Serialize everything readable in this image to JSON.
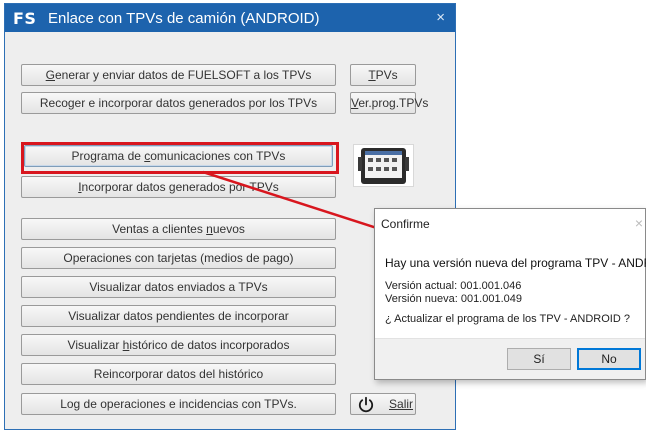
{
  "window": {
    "badge": "FS",
    "title": "Enlace con TPVs de camión (ANDROID)",
    "close": "×"
  },
  "buttons": {
    "generar": {
      "pre": "",
      "acc": "G",
      "post": "enerar y enviar datos de FUELSOFT a los TPVs"
    },
    "recoger": {
      "pre": "Recoger e incorporar datos generados por los TPVs",
      "acc": "",
      "post": ""
    },
    "programa": {
      "pre": "Programa de ",
      "acc": "c",
      "post": "omunicaciones con TPVs"
    },
    "incorporar": {
      "pre": "",
      "acc": "I",
      "post": "ncorporar datos generados por TPVs"
    },
    "ventas": {
      "pre": "Ventas a clientes ",
      "acc": "n",
      "post": "uevos"
    },
    "operaciones": {
      "pre": "Operaciones con tarjetas (medios de pago)",
      "acc": "",
      "post": ""
    },
    "visualizar_enviados": {
      "pre": "Visualizar datos enviados a TPVs",
      "acc": "",
      "post": ""
    },
    "visualizar_pendientes": {
      "pre": "Visualizar datos pendientes de incorporar",
      "acc": "",
      "post": ""
    },
    "visualizar_historico": {
      "pre": "Visualizar ",
      "acc": "h",
      "post": "istórico de datos incorporados"
    },
    "reincorporar": {
      "pre": "Reincorporar datos del histórico",
      "acc": "",
      "post": ""
    },
    "log": {
      "pre": "Log de operaciones e incidencias con TPVs.",
      "acc": "",
      "post": ""
    },
    "tpvs": {
      "pre": "",
      "acc": "T",
      "post": "PVs"
    },
    "ver_prog": {
      "pre": "",
      "acc": "V",
      "post": "er.prog.TPVs"
    },
    "salir": {
      "pre": "",
      "acc": "S",
      "post": "alir"
    }
  },
  "dialog": {
    "title": "Confirme",
    "close": "×",
    "message": "Hay una versión nueva del programa TPV - ANDROID.",
    "version_actual": "Versión actual: 001.001.046",
    "version_nueva": "Versión nueva: 001.001.049",
    "question": "¿ Actualizar el programa de los TPV - ANDROID ?",
    "yes": "Sí",
    "no": "No"
  },
  "colors": {
    "titlebar": "#1d63ad",
    "highlight": "#d8161e",
    "default_button_border": "#0078d7"
  },
  "icons": {
    "exit": "power-icon",
    "device": "tablet-icon"
  }
}
